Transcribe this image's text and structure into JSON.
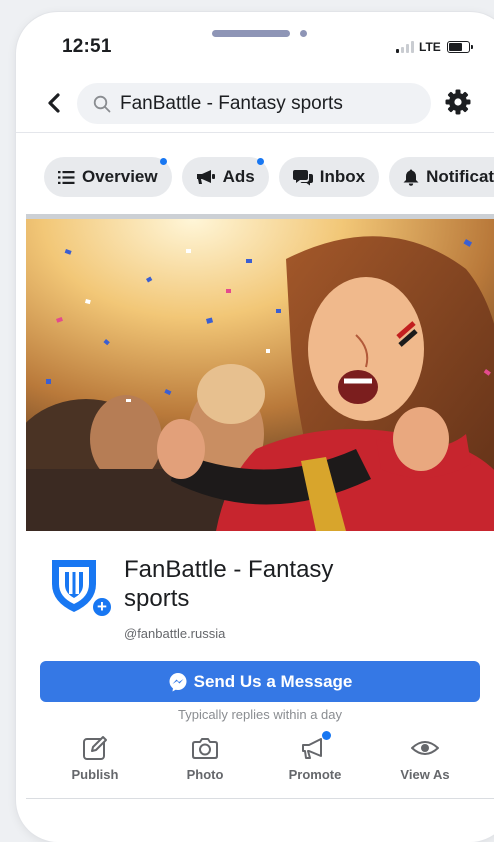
{
  "status_bar": {
    "time": "12:51",
    "network": "LTE"
  },
  "header": {
    "search_text": "FanBattle - Fantasy sports"
  },
  "tabs": [
    {
      "label": "Overview",
      "icon": "list-icon",
      "has_dot": true
    },
    {
      "label": "Ads",
      "icon": "megaphone-icon",
      "has_dot": true
    },
    {
      "label": "Inbox",
      "icon": "chat-icon",
      "has_dot": false
    },
    {
      "label": "Notifications",
      "icon": "bell-icon",
      "has_dot": false
    }
  ],
  "page": {
    "name": "FanBattle - Fantasy sports",
    "handle": "@fanbattle.russia",
    "message_button": "Send Us a Message",
    "reply_note": "Typically replies within a day"
  },
  "actions": [
    {
      "label": "Publish",
      "icon": "edit-icon"
    },
    {
      "label": "Photo",
      "icon": "camera-icon"
    },
    {
      "label": "Promote",
      "icon": "megaphone-icon"
    },
    {
      "label": "View As",
      "icon": "eye-icon"
    }
  ],
  "colors": {
    "accent": "#1877f2",
    "button": "#3578e5",
    "tab_bg": "#e8eaed"
  }
}
